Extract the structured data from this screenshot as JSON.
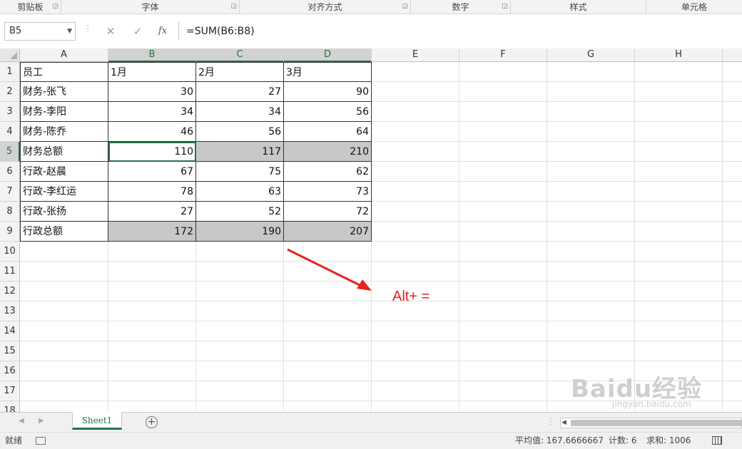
{
  "ribbon_groups": [
    "剪贴板",
    "字体",
    "对齐方式",
    "数字",
    "样式",
    "单元格"
  ],
  "formula_bar": {
    "name_box": "B5",
    "cancel_icon": "cross-icon",
    "enter_icon": "check-icon",
    "fx_label": "fx",
    "formula": "=SUM(B6:B8)"
  },
  "columns": [
    "A",
    "B",
    "C",
    "D",
    "E",
    "F",
    "G",
    "H"
  ],
  "rows": [
    "1",
    "2",
    "3",
    "4",
    "5",
    "6",
    "7",
    "8",
    "9",
    "10",
    "11",
    "12",
    "13",
    "14",
    "15",
    "16",
    "17",
    "18"
  ],
  "table": {
    "header": [
      "员工",
      "1月",
      "2月",
      "3月"
    ],
    "rows": [
      [
        "财务-张飞",
        "30",
        "27",
        "90"
      ],
      [
        "财务-李阳",
        "34",
        "34",
        "56"
      ],
      [
        "财务-陈乔",
        "46",
        "56",
        "64"
      ],
      [
        "财务总额",
        "110",
        "117",
        "210"
      ],
      [
        "行政-赵晨",
        "67",
        "75",
        "62"
      ],
      [
        "行政-李红运",
        "78",
        "63",
        "73"
      ],
      [
        "行政-张扬",
        "27",
        "52",
        "72"
      ],
      [
        "行政总额",
        "172",
        "190",
        "207"
      ]
    ]
  },
  "annotation": "Alt+ =",
  "sheet_tab": "Sheet1",
  "status": {
    "ready": "就绪",
    "average": "平均值: 167.6666667",
    "count": "计数: 6",
    "sum": "求和: 1006"
  },
  "watermark": "Baidu经验",
  "watermark_sub": "jingyan.baidu.com",
  "colors": {
    "accent": "#217346",
    "highlight": "#c8c8c8",
    "annotation": "#e8231c"
  }
}
